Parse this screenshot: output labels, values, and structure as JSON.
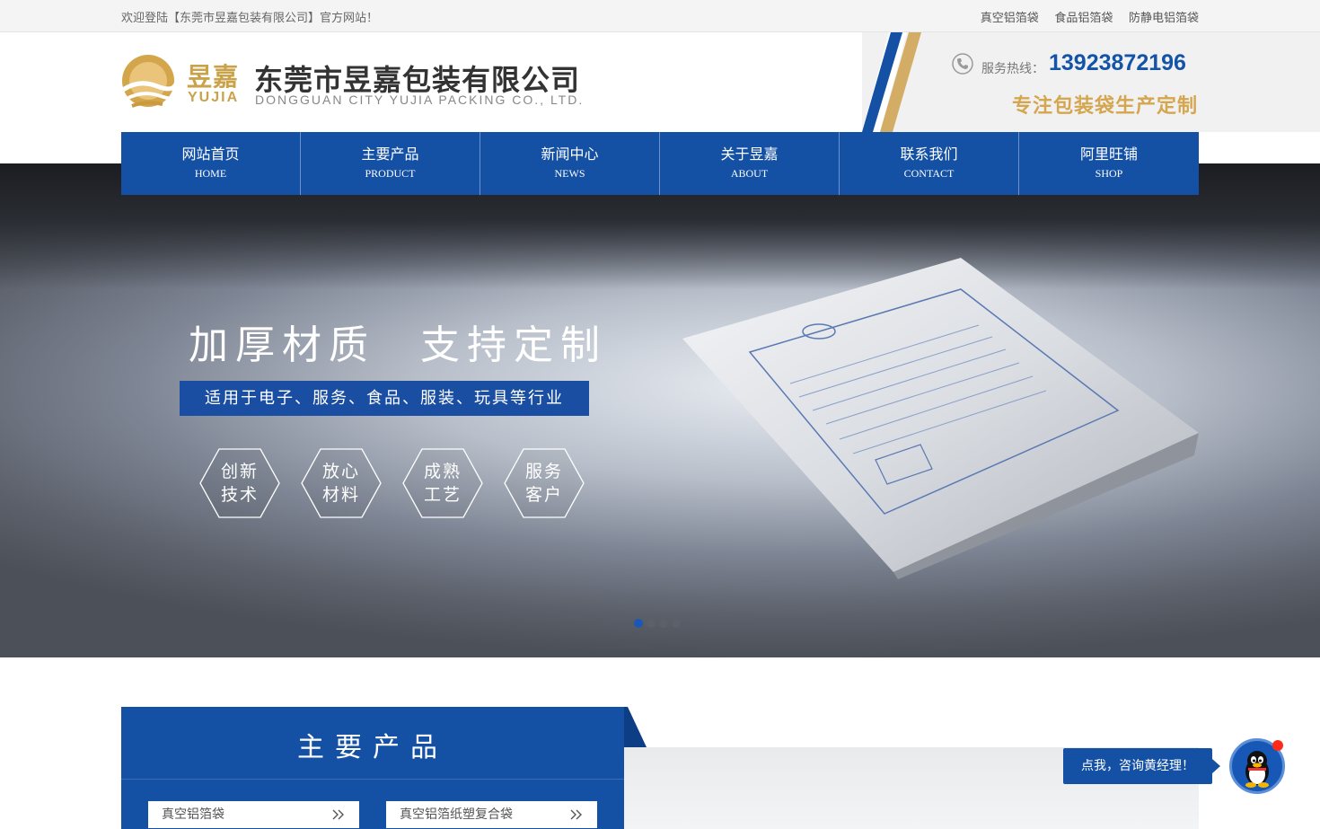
{
  "topbar": {
    "welcome": "欢迎登陆【东莞市昱嘉包装有限公司】官方网站！",
    "links": [
      "真空铝箔袋",
      "食品铝箔袋",
      "防静电铝箔袋"
    ]
  },
  "header": {
    "logo_cn_small": "昱嘉",
    "logo_en_small": "YUJIA",
    "logo_cn_big": "东莞市昱嘉包装有限公司",
    "logo_en_big": "DONGGUAN CITY YUJIA PACKING CO., LTD.",
    "hotline_label": "服务热线：",
    "hotline_number": "13923872196",
    "slogan": "专注包装袋生产定制"
  },
  "nav": [
    {
      "cn": "网站首页",
      "en": "HOME"
    },
    {
      "cn": "主要产品",
      "en": "PRODUCT"
    },
    {
      "cn": "新闻中心",
      "en": "NEWS"
    },
    {
      "cn": "关于昱嘉",
      "en": "ABOUT"
    },
    {
      "cn": "联系我们",
      "en": "CONTACT"
    },
    {
      "cn": "阿里旺铺",
      "en": "SHOP"
    }
  ],
  "banner": {
    "headline_left": "加厚材质",
    "headline_right": "支持定制",
    "subline": "适用于电子、服务、食品、服装、玩具等行业",
    "features": [
      {
        "line1": "创新",
        "line2": "技术"
      },
      {
        "line1": "放心",
        "line2": "材料"
      },
      {
        "line1": "成熟",
        "line2": "工艺"
      },
      {
        "line1": "服务",
        "line2": "客户"
      }
    ],
    "slide_count": 4,
    "active_slide": 1
  },
  "products": {
    "title": "主要产品",
    "categories": [
      "真空铝箔袋",
      "真空铝箔纸塑复合袋"
    ]
  },
  "consult": {
    "label": "点我，咨询黄经理！"
  },
  "colors": {
    "brand_blue": "#1451a5",
    "gold": "#d5a650",
    "hotline_blue": "#1353a8"
  }
}
